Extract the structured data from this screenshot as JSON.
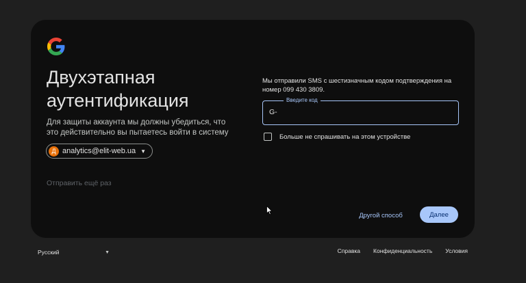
{
  "card": {
    "title": "Двухэтапная аутентификация",
    "subtitle": "Для защиты аккаунта мы должны убедиться, что это действительно вы пытаетесь войти в систему",
    "account": {
      "avatar_letter": "Д",
      "email": "analytics@elit-web.ua"
    },
    "resend_label": "Отправить ещё раз",
    "sms_message": "Мы отправили SMS с шестизначным кодом подтверждения на номер 099 430 3809.",
    "code_field": {
      "label": "Введите код",
      "value": "G-"
    },
    "remember_label": "Больше не спрашивать на этом устройстве",
    "other_way_label": "Другой способ",
    "next_label": "Далее"
  },
  "footer": {
    "language": "Русский",
    "links": [
      "Справка",
      "Конфиденциальность",
      "Условия"
    ]
  },
  "colors": {
    "accent": "#a8c7fa",
    "card_bg": "#0e0e0e",
    "page_bg": "#1f1f1f",
    "avatar_bg": "#e8710a"
  }
}
